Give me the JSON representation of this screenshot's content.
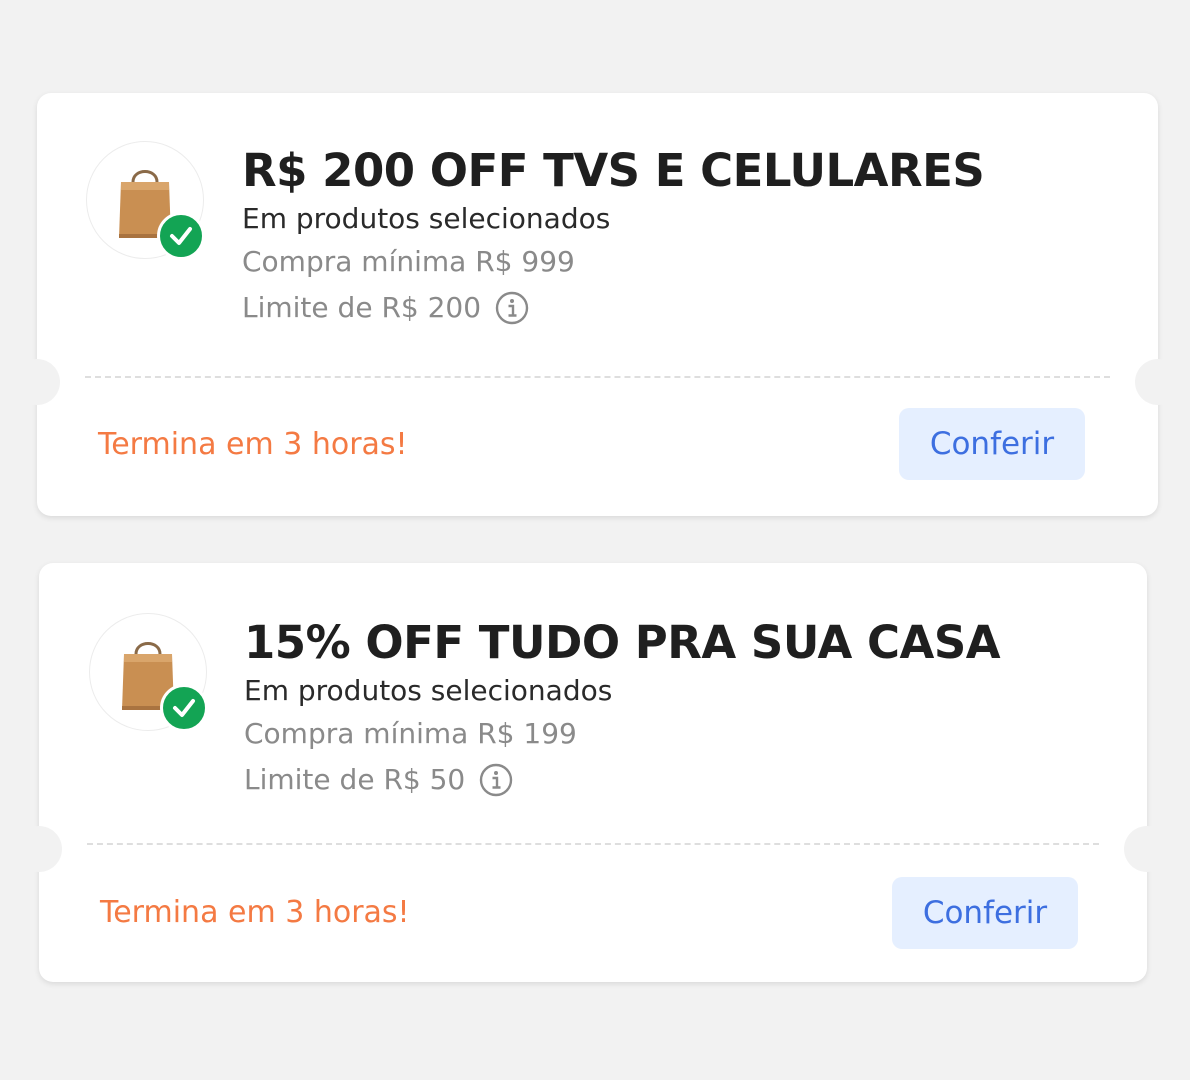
{
  "coupons": [
    {
      "title": "R$ 200 OFF TVS E CELULARES",
      "subtitle": "Em produtos selecionados",
      "min_purchase": "Compra mínima R$ 999",
      "limit": "Limite de R$ 200",
      "expiry": "Termina em 3 horas!",
      "button_label": "Conferir",
      "icon": "shopping-bag-icon",
      "badge_icon": "check-icon"
    },
    {
      "title": "15% OFF TUDO PRA SUA CASA",
      "subtitle": "Em produtos selecionados",
      "min_purchase": "Compra mínima R$ 199",
      "limit": "Limite de R$ 50",
      "expiry": "Termina em 3 horas!",
      "button_label": "Conferir",
      "icon": "shopping-bag-icon",
      "badge_icon": "check-icon"
    }
  ],
  "colors": {
    "background": "#f2f2f2",
    "card": "#ffffff",
    "title": "#1f1f1f",
    "muted": "#8a8a8a",
    "expiry": "#f47a43",
    "button_bg": "#e5efff",
    "button_text": "#3d6fe0",
    "check_badge": "#13a454",
    "bag": "#c98f52"
  }
}
